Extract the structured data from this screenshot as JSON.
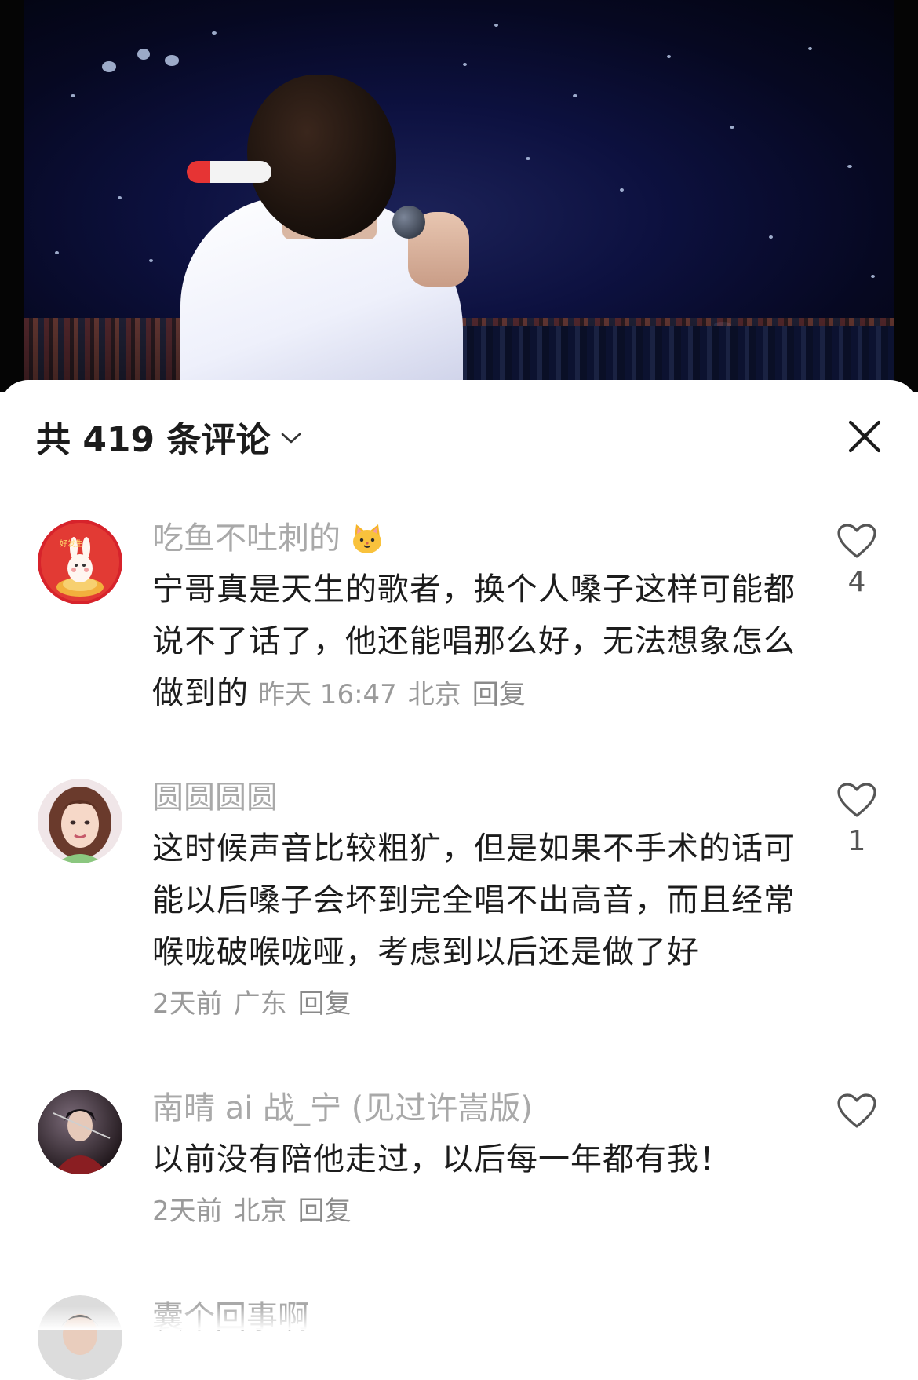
{
  "header": {
    "title": "共 419 条评论"
  },
  "comments": [
    {
      "username": "吃鱼不吐刺的",
      "text": "宁哥真是天生的歌者，换个人嗓子这样可能都说不了话了，他还能唱那么好，无法想象怎么做到的",
      "time": "昨天 16:47",
      "location": "北京",
      "reply_label": "回复",
      "likes": "4",
      "avatar_badge": "好发生"
    },
    {
      "username": "圆圆圆圆",
      "text": "这时候声音比较粗犷，但是如果不手术的话可能以后嗓子会坏到完全唱不出高音，而且经常喉咙破喉咙哑，考虑到以后还是做了好",
      "time": "2天前",
      "location": "广东",
      "reply_label": "回复",
      "likes": "1"
    },
    {
      "username": "南晴 ai 战_宁 (见过许嵩版)",
      "text": "以前没有陪他走过，以后每一年都有我！",
      "time": "2天前",
      "location": "北京",
      "reply_label": "回复",
      "likes": ""
    },
    {
      "username": "囊个回事啊"
    }
  ],
  "colors": {
    "username": "#a9a9a9",
    "text": "#1c1c1c",
    "meta": "#9a9a9a"
  }
}
